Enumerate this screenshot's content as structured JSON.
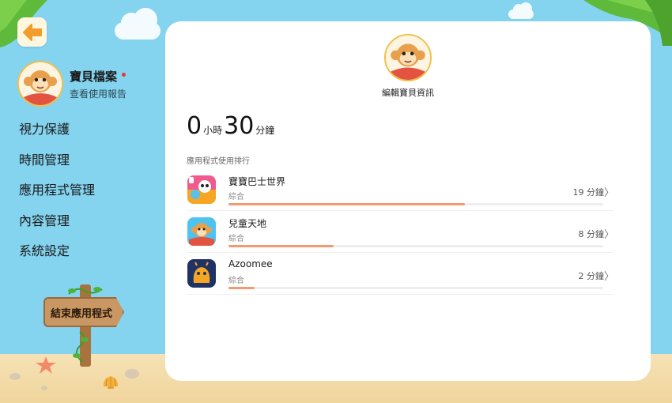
{
  "back_button": {
    "icon": "arrow-left-icon"
  },
  "profile": {
    "name": "寶貝檔案",
    "subtitle": "查看使用報告"
  },
  "nav": {
    "items": [
      {
        "label": "視力保護"
      },
      {
        "label": "時間管理"
      },
      {
        "label": "應用程式管理"
      },
      {
        "label": "內容管理"
      },
      {
        "label": "系統設定"
      }
    ]
  },
  "exit_sign": {
    "label": "結束應用程式"
  },
  "card": {
    "edit_label": "編輯寶貝資訊",
    "usage": {
      "hours": "0",
      "hours_unit": "小時",
      "minutes": "30",
      "minutes_unit": "分鐘"
    },
    "ranking_title": "應用程式使用排行",
    "apps": [
      {
        "name": "寶寶巴士世界",
        "category": "綜合",
        "time": "19 分鐘",
        "progress": 0.63
      },
      {
        "name": "兒童天地",
        "category": "綜合",
        "time": "8 分鐘",
        "progress": 0.28
      },
      {
        "name": "Azoomee",
        "category": "綜合",
        "time": "2 分鐘",
        "progress": 0.07
      }
    ]
  },
  "colors": {
    "sky": "#84d3ef",
    "progress": "#f39a70",
    "card": "#ffffff",
    "accent_orange": "#f2a13a"
  }
}
